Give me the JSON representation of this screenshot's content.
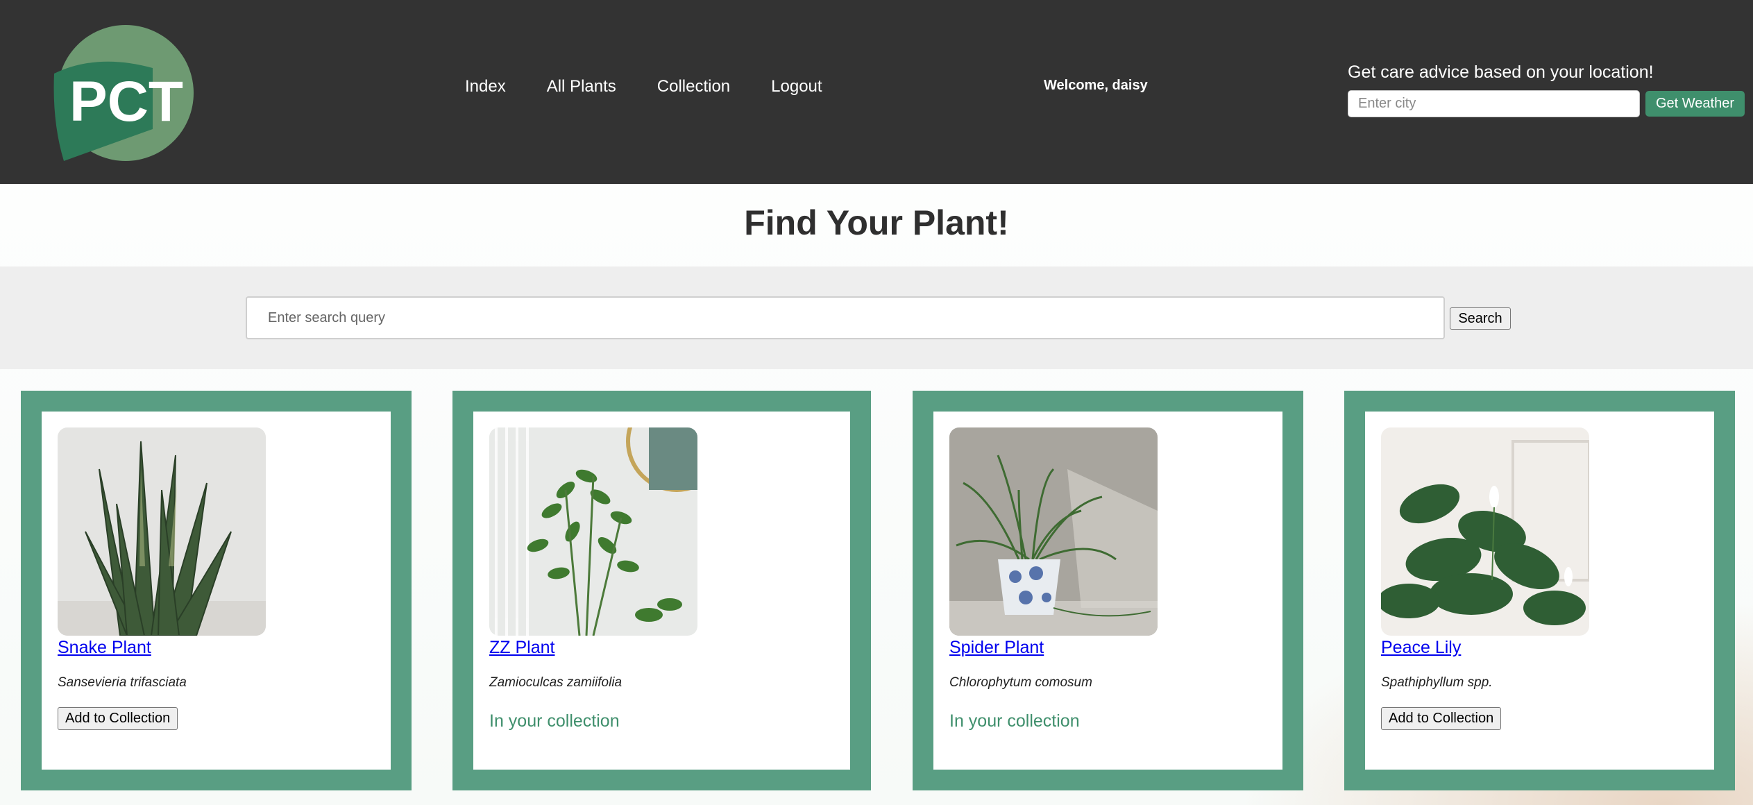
{
  "header": {
    "logo_text": "PCT",
    "nav": [
      {
        "label": "Index"
      },
      {
        "label": "All Plants"
      },
      {
        "label": "Collection"
      },
      {
        "label": "Logout"
      }
    ],
    "welcome": "Welcome, daisy",
    "weather": {
      "prompt": "Get care advice based on your location!",
      "placeholder": "Enter city",
      "button": "Get Weather"
    }
  },
  "main": {
    "title": "Find Your Plant!",
    "search": {
      "placeholder": "Enter search query",
      "button": "Search"
    },
    "plants": [
      {
        "name": "Snake Plant",
        "scientific": "Sansevieria trifasciata",
        "action": "Add to Collection"
      },
      {
        "name": "ZZ Plant",
        "scientific": "Zamioculcas zamiifolia",
        "status": "In your collection"
      },
      {
        "name": "Spider Plant",
        "scientific": "Chlorophytum comosum",
        "status": "In your collection"
      },
      {
        "name": "Peace Lily",
        "scientific": "Spathiphyllum spp.",
        "action": "Add to Collection"
      }
    ]
  },
  "colors": {
    "header_bg": "#333333",
    "accent_green": "#3f8f6c",
    "card_border": "#599e83",
    "search_band": "#eeeeee"
  }
}
